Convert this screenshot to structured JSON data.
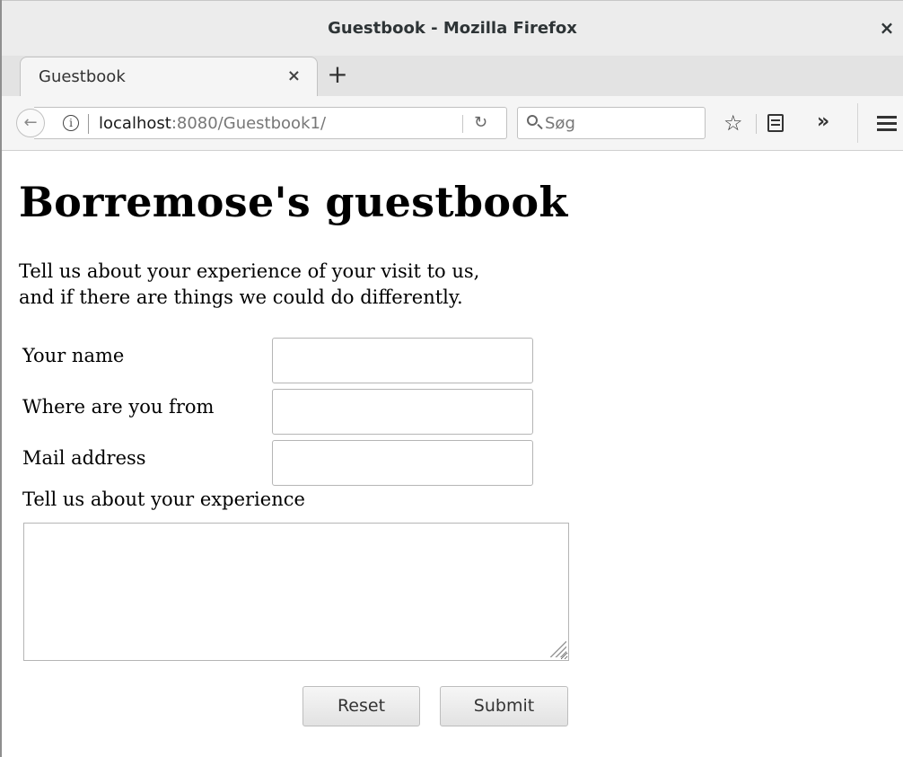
{
  "window": {
    "title": "Guestbook - Mozilla Firefox",
    "close_glyph": "×"
  },
  "tabs": [
    {
      "label": "Guestbook",
      "close_glyph": "×"
    }
  ],
  "new_tab_glyph": "+",
  "navbar": {
    "back_glyph": "←",
    "url_host": "localhost",
    "url_rest": ":8080/Guestbook1/",
    "reload_glyph": "↻",
    "search_placeholder": "Søg",
    "star_glyph": "☆",
    "overflow_glyph": "»",
    "icons": [
      "back-arrow-icon",
      "info-icon",
      "reload-icon",
      "search-icon",
      "bookmark-star-icon",
      "library-icon",
      "overflow-icon",
      "hamburger-menu-icon"
    ]
  },
  "page": {
    "heading": "Borremose's guestbook",
    "intro_line1": "Tell us about your experience of your visit to us,",
    "intro_line2": "and if there are things we could do differently.",
    "form": {
      "name_label": "Your name",
      "name_value": "",
      "origin_label": "Where are you from",
      "origin_value": "",
      "mail_label": "Mail address",
      "mail_value": "",
      "experience_label": "Tell us about your experience",
      "experience_value": "",
      "reset_label": "Reset",
      "submit_label": "Submit"
    }
  }
}
